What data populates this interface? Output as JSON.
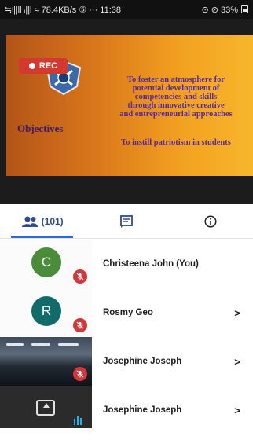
{
  "status_bar": {
    "left_text": "≒ᵎ||ll ᵢ||l ≈ 78.4KB/s ⑤ ··· 11:38",
    "right_text": "⊙ ⊘ 33%"
  },
  "recording": {
    "label": "REC"
  },
  "slide": {
    "heading": "Objectives",
    "lines": [
      "To foster an atmosphere for",
      "potential development of",
      "competencies and skills",
      "through innovative creative",
      "and entrepreneurial approaches"
    ],
    "line_last": "To instill patriotism in students"
  },
  "tabs": [
    {
      "id": "participants",
      "count": "(101)",
      "icon": "people-icon",
      "active": true
    },
    {
      "id": "chat",
      "icon": "chat-icon",
      "active": false
    },
    {
      "id": "info",
      "icon": "info-icon",
      "active": false
    }
  ],
  "participants": [
    {
      "initial": "C",
      "name": "Christeena John (You)",
      "avatar_color": "#4a8c3a",
      "muted": true,
      "has_chevron": false
    },
    {
      "initial": "R",
      "name": "Rosmy Geo",
      "avatar_color": "#116c69",
      "muted": true,
      "has_chevron": true
    },
    {
      "name": "Josephine Joseph",
      "media": "camera",
      "muted": true,
      "has_chevron": true
    },
    {
      "name": "Josephine Joseph",
      "media": "screen-share",
      "speaking": true,
      "has_chevron": true
    }
  ],
  "chevron_glyph": ">"
}
